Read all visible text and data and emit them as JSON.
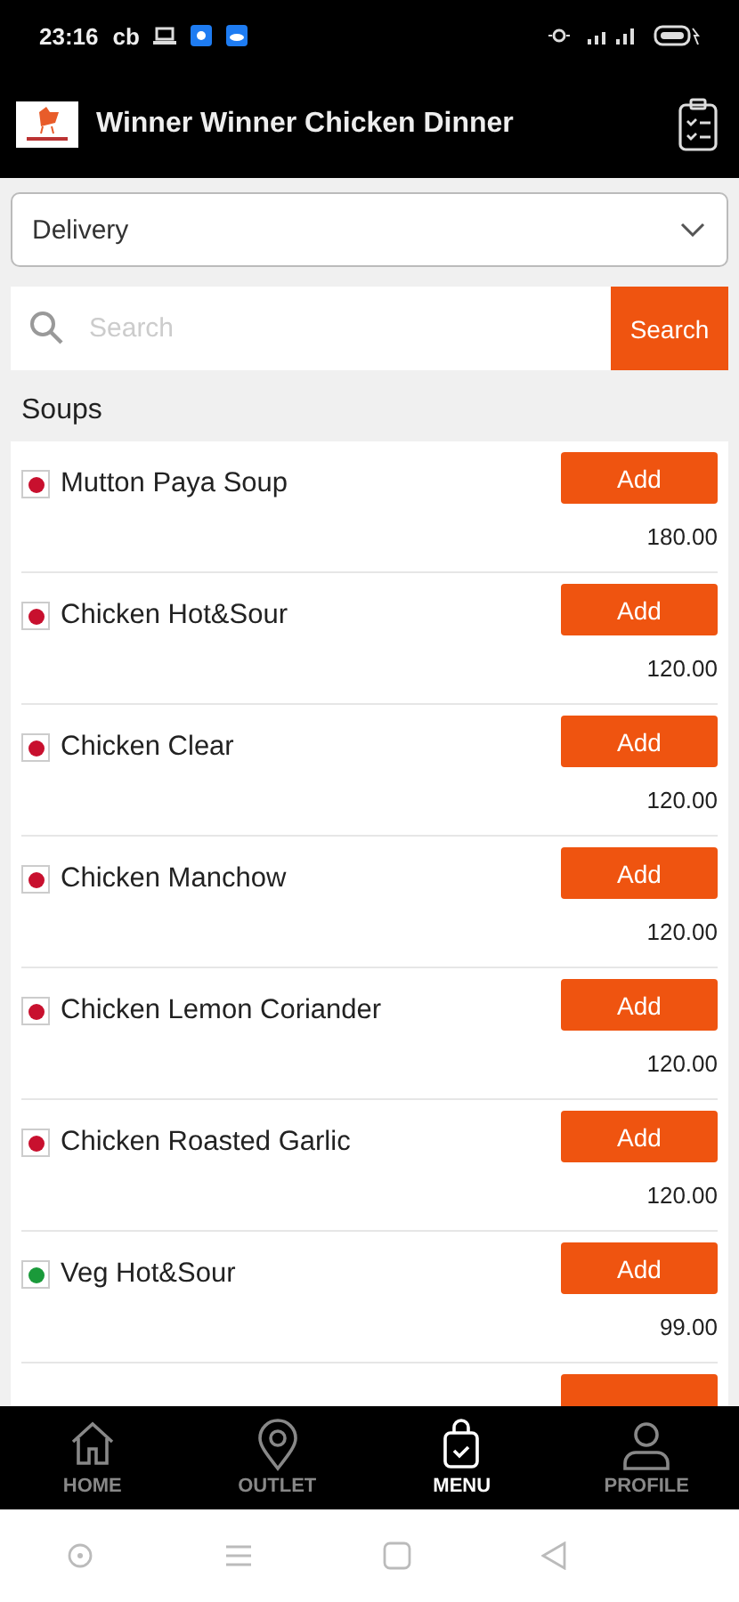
{
  "status_bar": {
    "time": "23:16",
    "carrier": "cb"
  },
  "header": {
    "title": "Winner Winner Chicken Dinner"
  },
  "order_type": {
    "value": "Delivery"
  },
  "search": {
    "placeholder": "Search",
    "button": "Search"
  },
  "category": "Soups",
  "items": [
    {
      "name": "Mutton Paya Soup",
      "price": "180.00",
      "veg": false,
      "button": "Add"
    },
    {
      "name": "Chicken Hot&Sour",
      "price": "120.00",
      "veg": false,
      "button": "Add"
    },
    {
      "name": "Chicken Clear",
      "price": "120.00",
      "veg": false,
      "button": "Add"
    },
    {
      "name": "Chicken Manchow",
      "price": "120.00",
      "veg": false,
      "button": "Add"
    },
    {
      "name": "Chicken Lemon Coriander",
      "price": "120.00",
      "veg": false,
      "button": "Add"
    },
    {
      "name": "Chicken Roasted Garlic",
      "price": "120.00",
      "veg": false,
      "button": "Add"
    },
    {
      "name": "Veg Hot&Sour",
      "price": "99.00",
      "veg": true,
      "button": "Add"
    }
  ],
  "bottom_nav": [
    {
      "label": "HOME",
      "kind": "home",
      "selected": false
    },
    {
      "label": "OUTLET",
      "kind": "location",
      "selected": false
    },
    {
      "label": "MENU",
      "kind": "bag",
      "selected": true
    },
    {
      "label": "PROFILE",
      "kind": "person",
      "selected": false
    }
  ]
}
